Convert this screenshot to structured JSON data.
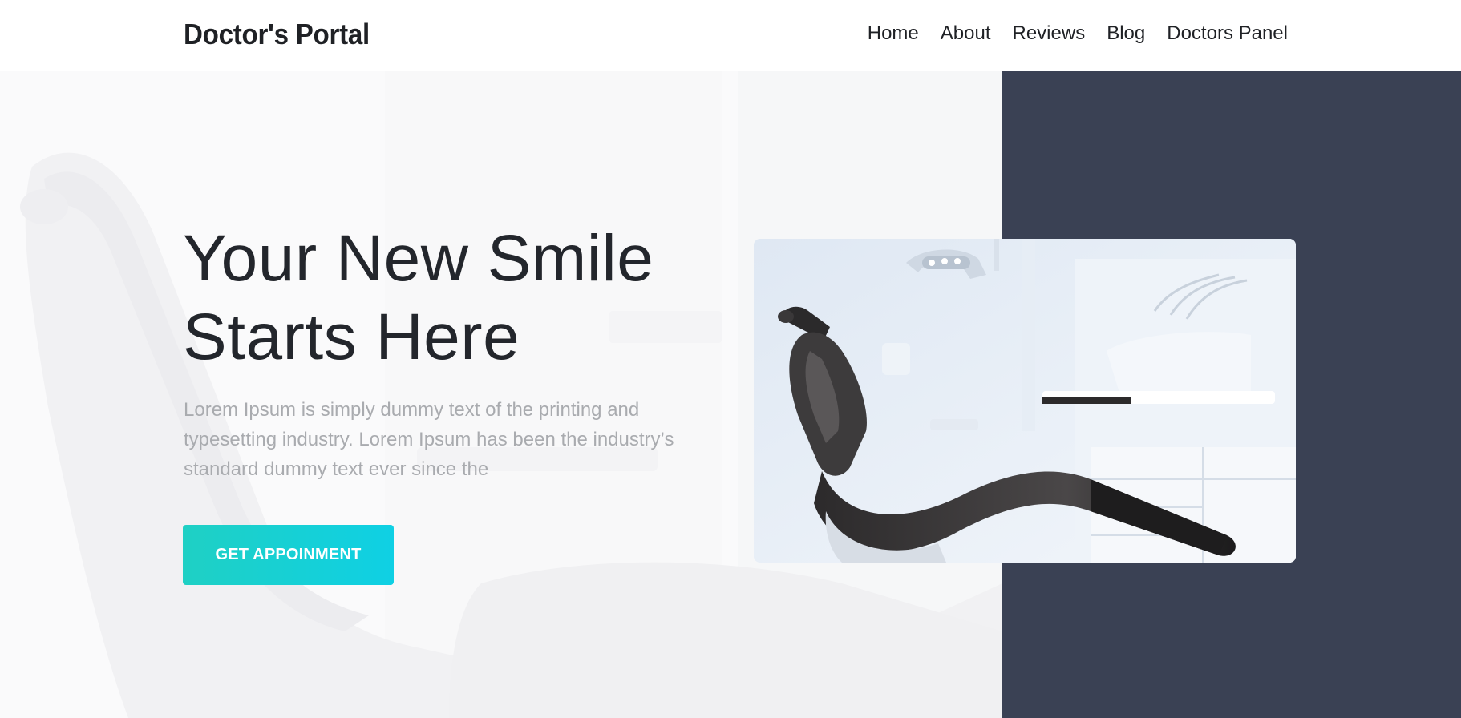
{
  "header": {
    "brand": "Doctor's Portal",
    "nav": [
      {
        "label": "Home"
      },
      {
        "label": "About"
      },
      {
        "label": "Reviews"
      },
      {
        "label": "Blog"
      },
      {
        "label": "Doctors Panel"
      }
    ]
  },
  "hero": {
    "title_line1": "Your New Smile",
    "title_line2": "Starts Here",
    "description": "Lorem Ipsum is simply dummy text of the printing and typesetting industry. Lorem Ipsum has been the industry’s standard dummy text ever since the",
    "cta_label": "GET APPOINMENT",
    "image": "dental-chair-photo"
  },
  "colors": {
    "brand_text": "#1f2125",
    "cta_gradient_start": "#1fd0c4",
    "cta_gradient_end": "#0fd0e4",
    "panel_dark": "#3a4154",
    "body_text_muted": "#a9abaf"
  }
}
